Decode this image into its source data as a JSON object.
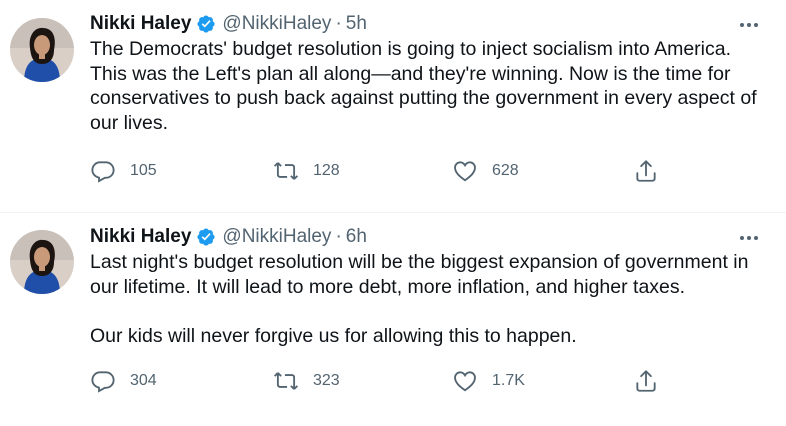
{
  "tweets": [
    {
      "author_name": "Nikki Haley",
      "handle": "@NikkiHaley",
      "separator": "·",
      "time": "5h",
      "paragraphs": [
        "The Democrats' budget resolution is going to inject socialism into America. This was the Left's plan all along—and they're winning. Now is the time for conservatives to push back against putting the government in every aspect of our lives."
      ],
      "replies": "105",
      "retweets": "128",
      "likes": "628"
    },
    {
      "author_name": "Nikki Haley",
      "handle": "@NikkiHaley",
      "separator": "·",
      "time": "6h",
      "paragraphs": [
        "Last night's budget resolution will be the biggest expansion of government in our lifetime. It will lead to more debt, more inflation, and higher taxes.",
        "Our kids will never forgive us for allowing this to happen."
      ],
      "replies": "304",
      "retweets": "323",
      "likes": "1.7K"
    }
  ],
  "icons": {
    "verified": "verified-badge-icon",
    "more": "more-horizontal-icon",
    "reply": "reply-bubble-icon",
    "retweet": "retweet-arrows-icon",
    "like": "heart-icon",
    "share": "share-upload-icon"
  },
  "colors": {
    "text": "#0f1419",
    "secondary": "#536471",
    "verified": "#1d9bf0",
    "divider": "#eff3f4"
  }
}
